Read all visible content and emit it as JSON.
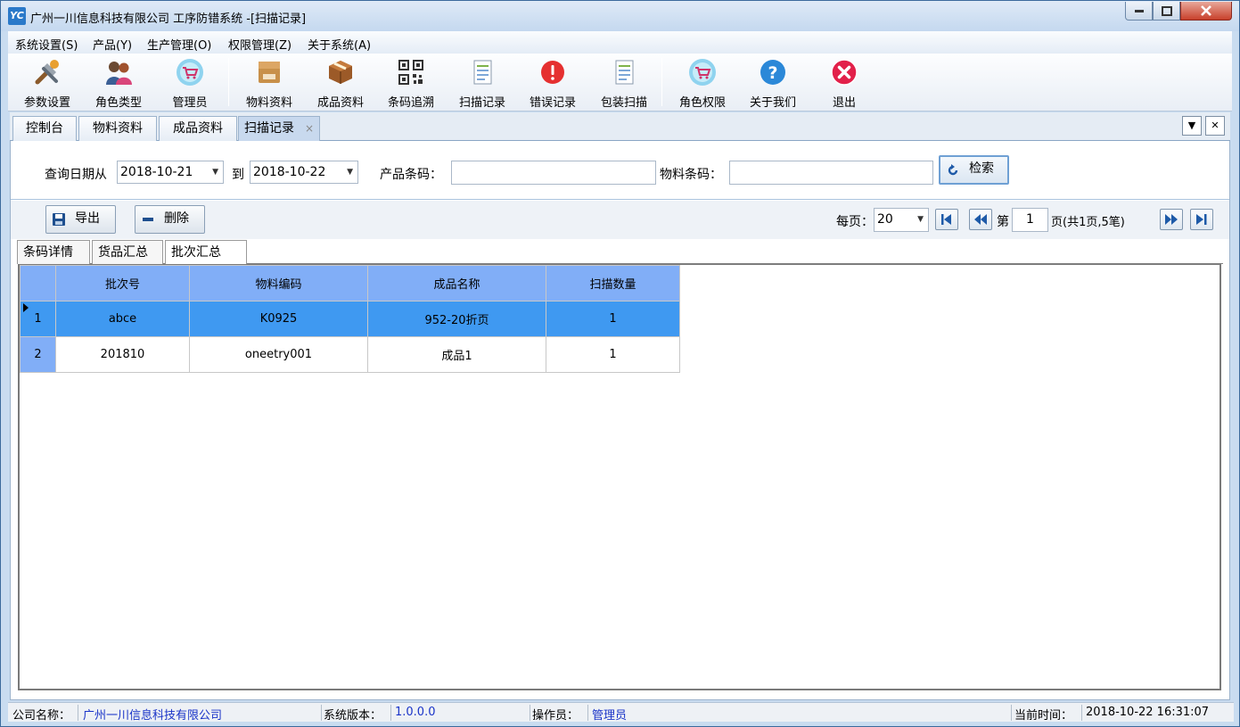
{
  "window": {
    "title": "广州一川信息科技有限公司 工序防错系统 -[扫描记录]",
    "logo_text": "YC"
  },
  "menu": [
    {
      "label": "系统设置(S)"
    },
    {
      "label": "产品(Y)"
    },
    {
      "label": "生产管理(O)"
    },
    {
      "label": "权限管理(Z)"
    },
    {
      "label": "关于系统(A)"
    }
  ],
  "toolbar": {
    "buttons": [
      {
        "label": "参数设置",
        "icon": "tools-icon"
      },
      {
        "label": "角色类型",
        "icon": "users-icon"
      },
      {
        "label": "管理员",
        "icon": "cart-icon"
      },
      {
        "label": "物料资料",
        "icon": "box-icon"
      },
      {
        "label": "成品资料",
        "icon": "package-icon"
      },
      {
        "label": "条码追溯",
        "icon": "qrcode-icon"
      },
      {
        "label": "扫描记录",
        "icon": "document-icon"
      },
      {
        "label": "错误记录",
        "icon": "error-icon"
      },
      {
        "label": "包装扫描",
        "icon": "document-icon"
      },
      {
        "label": "角色权限",
        "icon": "cart-icon"
      },
      {
        "label": "关于我们",
        "icon": "help-icon"
      },
      {
        "label": "退出",
        "icon": "exit-icon"
      }
    ]
  },
  "doc_tabs": [
    {
      "label": "控制台"
    },
    {
      "label": "物料资料"
    },
    {
      "label": "成品资料"
    },
    {
      "label": "扫描记录",
      "close": "×"
    }
  ],
  "strip": {
    "dropdown": "▼",
    "close": "✕"
  },
  "search": {
    "date_from_label": "查询日期从",
    "date_from": "2018-10-21",
    "date_to_label": "到",
    "date_to": "2018-10-22",
    "product_code_label": "产品条码：",
    "product_code_value": "",
    "material_code_label": "物料条码：",
    "material_code_value": "",
    "search_button": "检索"
  },
  "actions": {
    "export_button": "导出",
    "delete_button": "删除",
    "page_size_label": "每页：",
    "page_size": "20",
    "page_prefix": "第",
    "page_number": "1",
    "page_info": "页(共1页,5笔)"
  },
  "sub_tabs": [
    {
      "label": "条码详情"
    },
    {
      "label": "货品汇总"
    },
    {
      "label": "批次汇总"
    }
  ],
  "grid": {
    "columns": [
      "批次号",
      "物料编码",
      "成品名称",
      "扫描数量"
    ],
    "rows": [
      {
        "index": "1",
        "cells": [
          "abce",
          "K0925",
          "952-20折页",
          "1"
        ],
        "selected": true
      },
      {
        "index": "2",
        "cells": [
          "201810",
          "oneetry001",
          "成品1",
          "1"
        ],
        "selected": false
      }
    ]
  },
  "status": {
    "company_label": "公司名称：",
    "company_value": "广州一川信息科技有限公司",
    "version_label": "系统版本：",
    "version_value": "1.0.0.0",
    "operator_label": "操作员：",
    "operator_value": "管理员",
    "time_label": "当前时间：",
    "time_value": "2018-10-22 16:31:07"
  },
  "colors": {
    "grid_header": "#81aef7",
    "grid_selected": "#3f99f1",
    "status_value": "#1a34c8"
  }
}
